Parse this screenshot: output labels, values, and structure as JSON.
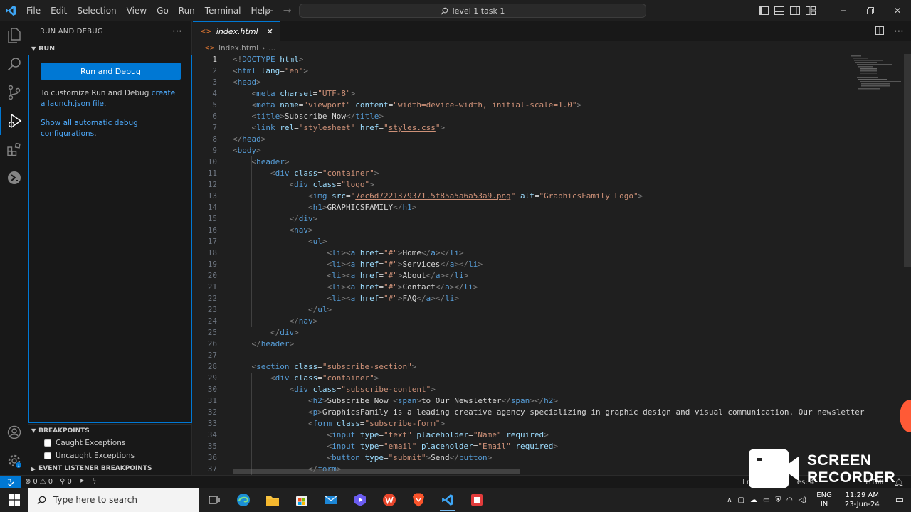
{
  "menu": [
    "File",
    "Edit",
    "Selection",
    "View",
    "Go",
    "Run",
    "Terminal",
    "Help"
  ],
  "command_center": {
    "text": "level 1 task 1"
  },
  "sidebar": {
    "header": "RUN AND DEBUG",
    "section": "RUN",
    "run_button": "Run and Debug",
    "customize_prefix": "To customize Run and Debug ",
    "customize_link": "create a launch.json file",
    "customize_suffix": ".",
    "show_all_link": "Show all automatic debug configurations",
    "show_all_suffix": ".",
    "breakpoints_title": "BREAKPOINTS",
    "caught": "Caught Exceptions",
    "uncaught": "Uncaught Exceptions",
    "event_listener": "EVENT LISTENER BREAKPOINTS"
  },
  "editor": {
    "tab": "index.html",
    "breadcrumb_file": "index.html",
    "breadcrumb_more": "..."
  },
  "code_lines": [
    [
      [
        "br",
        "<!"
      ],
      [
        "tag",
        "DOCTYPE"
      ],
      [
        "txt",
        " "
      ],
      [
        "attr",
        "html"
      ],
      [
        "br",
        ">"
      ]
    ],
    [
      [
        "br",
        "<"
      ],
      [
        "tag",
        "html"
      ],
      [
        "txt",
        " "
      ],
      [
        "attr",
        "lang"
      ],
      [
        "txt",
        "="
      ],
      [
        "str",
        "\"en\""
      ],
      [
        "br",
        ">"
      ]
    ],
    [
      [
        "br",
        "<"
      ],
      [
        "tag",
        "head"
      ],
      [
        "br",
        ">"
      ]
    ],
    [
      [
        "txt",
        "    "
      ],
      [
        "br",
        "<"
      ],
      [
        "tag",
        "meta"
      ],
      [
        "txt",
        " "
      ],
      [
        "attr",
        "charset"
      ],
      [
        "txt",
        "="
      ],
      [
        "str",
        "\"UTF-8\""
      ],
      [
        "br",
        ">"
      ]
    ],
    [
      [
        "txt",
        "    "
      ],
      [
        "br",
        "<"
      ],
      [
        "tag",
        "meta"
      ],
      [
        "txt",
        " "
      ],
      [
        "attr",
        "name"
      ],
      [
        "txt",
        "="
      ],
      [
        "str",
        "\"viewport\""
      ],
      [
        "txt",
        " "
      ],
      [
        "attr",
        "content"
      ],
      [
        "txt",
        "="
      ],
      [
        "str",
        "\"width=device-width, initial-scale=1.0\""
      ],
      [
        "br",
        ">"
      ]
    ],
    [
      [
        "txt",
        "    "
      ],
      [
        "br",
        "<"
      ],
      [
        "tag",
        "title"
      ],
      [
        "br",
        ">"
      ],
      [
        "txt",
        "Subscribe Now"
      ],
      [
        "br",
        "</"
      ],
      [
        "tag",
        "title"
      ],
      [
        "br",
        ">"
      ]
    ],
    [
      [
        "txt",
        "    "
      ],
      [
        "br",
        "<"
      ],
      [
        "tag",
        "link"
      ],
      [
        "txt",
        " "
      ],
      [
        "attr",
        "rel"
      ],
      [
        "txt",
        "="
      ],
      [
        "str",
        "\"stylesheet\""
      ],
      [
        "txt",
        " "
      ],
      [
        "attr",
        "href"
      ],
      [
        "txt",
        "="
      ],
      [
        "str",
        "\""
      ],
      [
        "stru",
        "styles.css"
      ],
      [
        "str",
        "\""
      ],
      [
        "br",
        ">"
      ]
    ],
    [
      [
        "br",
        "</"
      ],
      [
        "tag",
        "head"
      ],
      [
        "br",
        ">"
      ]
    ],
    [
      [
        "br",
        "<"
      ],
      [
        "tag",
        "body"
      ],
      [
        "br",
        ">"
      ]
    ],
    [
      [
        "txt",
        "    "
      ],
      [
        "br",
        "<"
      ],
      [
        "tag",
        "header"
      ],
      [
        "br",
        ">"
      ]
    ],
    [
      [
        "txt",
        "        "
      ],
      [
        "br",
        "<"
      ],
      [
        "tag",
        "div"
      ],
      [
        "txt",
        " "
      ],
      [
        "attr",
        "class"
      ],
      [
        "txt",
        "="
      ],
      [
        "str",
        "\"container\""
      ],
      [
        "br",
        ">"
      ]
    ],
    [
      [
        "txt",
        "            "
      ],
      [
        "br",
        "<"
      ],
      [
        "tag",
        "div"
      ],
      [
        "txt",
        " "
      ],
      [
        "attr",
        "class"
      ],
      [
        "txt",
        "="
      ],
      [
        "str",
        "\"logo\""
      ],
      [
        "br",
        ">"
      ]
    ],
    [
      [
        "txt",
        "                "
      ],
      [
        "br",
        "<"
      ],
      [
        "tag",
        "img"
      ],
      [
        "txt",
        " "
      ],
      [
        "attr",
        "src"
      ],
      [
        "txt",
        "="
      ],
      [
        "str",
        "\""
      ],
      [
        "stru",
        "7ec6d7221379371.5f85a5a6a53a9.png"
      ],
      [
        "str",
        "\""
      ],
      [
        "txt",
        " "
      ],
      [
        "attr",
        "alt"
      ],
      [
        "txt",
        "="
      ],
      [
        "str",
        "\"GraphicsFamily Logo\""
      ],
      [
        "br",
        ">"
      ]
    ],
    [
      [
        "txt",
        "                "
      ],
      [
        "br",
        "<"
      ],
      [
        "tag",
        "h1"
      ],
      [
        "br",
        ">"
      ],
      [
        "txt",
        "GRAPHICSFAMILY"
      ],
      [
        "br",
        "</"
      ],
      [
        "tag",
        "h1"
      ],
      [
        "br",
        ">"
      ]
    ],
    [
      [
        "txt",
        "            "
      ],
      [
        "br",
        "</"
      ],
      [
        "tag",
        "div"
      ],
      [
        "br",
        ">"
      ]
    ],
    [
      [
        "txt",
        "            "
      ],
      [
        "br",
        "<"
      ],
      [
        "tag",
        "nav"
      ],
      [
        "br",
        ">"
      ]
    ],
    [
      [
        "txt",
        "                "
      ],
      [
        "br",
        "<"
      ],
      [
        "tag",
        "ul"
      ],
      [
        "br",
        ">"
      ]
    ],
    [
      [
        "txt",
        "                    "
      ],
      [
        "br",
        "<"
      ],
      [
        "tag",
        "li"
      ],
      [
        "br",
        "><"
      ],
      [
        "tag",
        "a"
      ],
      [
        "txt",
        " "
      ],
      [
        "attr",
        "href"
      ],
      [
        "txt",
        "="
      ],
      [
        "str",
        "\"#\""
      ],
      [
        "br",
        ">"
      ],
      [
        "txt",
        "Home"
      ],
      [
        "br",
        "</"
      ],
      [
        "tag",
        "a"
      ],
      [
        "br",
        "></"
      ],
      [
        "tag",
        "li"
      ],
      [
        "br",
        ">"
      ]
    ],
    [
      [
        "txt",
        "                    "
      ],
      [
        "br",
        "<"
      ],
      [
        "tag",
        "li"
      ],
      [
        "br",
        "><"
      ],
      [
        "tag",
        "a"
      ],
      [
        "txt",
        " "
      ],
      [
        "attr",
        "href"
      ],
      [
        "txt",
        "="
      ],
      [
        "str",
        "\"#\""
      ],
      [
        "br",
        ">"
      ],
      [
        "txt",
        "Services"
      ],
      [
        "br",
        "</"
      ],
      [
        "tag",
        "a"
      ],
      [
        "br",
        "></"
      ],
      [
        "tag",
        "li"
      ],
      [
        "br",
        ">"
      ]
    ],
    [
      [
        "txt",
        "                    "
      ],
      [
        "br",
        "<"
      ],
      [
        "tag",
        "li"
      ],
      [
        "br",
        "><"
      ],
      [
        "tag",
        "a"
      ],
      [
        "txt",
        " "
      ],
      [
        "attr",
        "href"
      ],
      [
        "txt",
        "="
      ],
      [
        "str",
        "\"#\""
      ],
      [
        "br",
        ">"
      ],
      [
        "txt",
        "About"
      ],
      [
        "br",
        "</"
      ],
      [
        "tag",
        "a"
      ],
      [
        "br",
        "></"
      ],
      [
        "tag",
        "li"
      ],
      [
        "br",
        ">"
      ]
    ],
    [
      [
        "txt",
        "                    "
      ],
      [
        "br",
        "<"
      ],
      [
        "tag",
        "li"
      ],
      [
        "br",
        "><"
      ],
      [
        "tag",
        "a"
      ],
      [
        "txt",
        " "
      ],
      [
        "attr",
        "href"
      ],
      [
        "txt",
        "="
      ],
      [
        "str",
        "\"#\""
      ],
      [
        "br",
        ">"
      ],
      [
        "txt",
        "Contact"
      ],
      [
        "br",
        "</"
      ],
      [
        "tag",
        "a"
      ],
      [
        "br",
        "></"
      ],
      [
        "tag",
        "li"
      ],
      [
        "br",
        ">"
      ]
    ],
    [
      [
        "txt",
        "                    "
      ],
      [
        "br",
        "<"
      ],
      [
        "tag",
        "li"
      ],
      [
        "br",
        "><"
      ],
      [
        "tag",
        "a"
      ],
      [
        "txt",
        " "
      ],
      [
        "attr",
        "href"
      ],
      [
        "txt",
        "="
      ],
      [
        "str",
        "\"#\""
      ],
      [
        "br",
        ">"
      ],
      [
        "txt",
        "FAQ"
      ],
      [
        "br",
        "</"
      ],
      [
        "tag",
        "a"
      ],
      [
        "br",
        "></"
      ],
      [
        "tag",
        "li"
      ],
      [
        "br",
        ">"
      ]
    ],
    [
      [
        "txt",
        "                "
      ],
      [
        "br",
        "</"
      ],
      [
        "tag",
        "ul"
      ],
      [
        "br",
        ">"
      ]
    ],
    [
      [
        "txt",
        "            "
      ],
      [
        "br",
        "</"
      ],
      [
        "tag",
        "nav"
      ],
      [
        "br",
        ">"
      ]
    ],
    [
      [
        "txt",
        "        "
      ],
      [
        "br",
        "</"
      ],
      [
        "tag",
        "div"
      ],
      [
        "br",
        ">"
      ]
    ],
    [
      [
        "txt",
        "    "
      ],
      [
        "br",
        "</"
      ],
      [
        "tag",
        "header"
      ],
      [
        "br",
        ">"
      ]
    ],
    [],
    [
      [
        "txt",
        "    "
      ],
      [
        "br",
        "<"
      ],
      [
        "tag",
        "section"
      ],
      [
        "txt",
        " "
      ],
      [
        "attr",
        "class"
      ],
      [
        "txt",
        "="
      ],
      [
        "str",
        "\"subscribe-section\""
      ],
      [
        "br",
        ">"
      ]
    ],
    [
      [
        "txt",
        "        "
      ],
      [
        "br",
        "<"
      ],
      [
        "tag",
        "div"
      ],
      [
        "txt",
        " "
      ],
      [
        "attr",
        "class"
      ],
      [
        "txt",
        "="
      ],
      [
        "str",
        "\"container\""
      ],
      [
        "br",
        ">"
      ]
    ],
    [
      [
        "txt",
        "            "
      ],
      [
        "br",
        "<"
      ],
      [
        "tag",
        "div"
      ],
      [
        "txt",
        " "
      ],
      [
        "attr",
        "class"
      ],
      [
        "txt",
        "="
      ],
      [
        "str",
        "\"subscribe-content\""
      ],
      [
        "br",
        ">"
      ]
    ],
    [
      [
        "txt",
        "                "
      ],
      [
        "br",
        "<"
      ],
      [
        "tag",
        "h2"
      ],
      [
        "br",
        ">"
      ],
      [
        "txt",
        "Subscribe Now "
      ],
      [
        "br",
        "<"
      ],
      [
        "tag",
        "span"
      ],
      [
        "br",
        ">"
      ],
      [
        "txt",
        "to Our Newsletter"
      ],
      [
        "br",
        "</"
      ],
      [
        "tag",
        "span"
      ],
      [
        "br",
        "></"
      ],
      [
        "tag",
        "h2"
      ],
      [
        "br",
        ">"
      ]
    ],
    [
      [
        "txt",
        "                "
      ],
      [
        "br",
        "<"
      ],
      [
        "tag",
        "p"
      ],
      [
        "br",
        ">"
      ],
      [
        "txt",
        "GraphicsFamily is a leading creative agency specializing in graphic design and visual communication. Our newsletter"
      ]
    ],
    [
      [
        "txt",
        "                "
      ],
      [
        "br",
        "<"
      ],
      [
        "tag",
        "form"
      ],
      [
        "txt",
        " "
      ],
      [
        "attr",
        "class"
      ],
      [
        "txt",
        "="
      ],
      [
        "str",
        "\"subscribe-form\""
      ],
      [
        "br",
        ">"
      ]
    ],
    [
      [
        "txt",
        "                    "
      ],
      [
        "br",
        "<"
      ],
      [
        "tag",
        "input"
      ],
      [
        "txt",
        " "
      ],
      [
        "attr",
        "type"
      ],
      [
        "txt",
        "="
      ],
      [
        "str",
        "\"text\""
      ],
      [
        "txt",
        " "
      ],
      [
        "attr",
        "placeholder"
      ],
      [
        "txt",
        "="
      ],
      [
        "str",
        "\"Name\""
      ],
      [
        "txt",
        " "
      ],
      [
        "attr",
        "required"
      ],
      [
        "br",
        ">"
      ]
    ],
    [
      [
        "txt",
        "                    "
      ],
      [
        "br",
        "<"
      ],
      [
        "tag",
        "input"
      ],
      [
        "txt",
        " "
      ],
      [
        "attr",
        "type"
      ],
      [
        "txt",
        "="
      ],
      [
        "str",
        "\"email\""
      ],
      [
        "txt",
        " "
      ],
      [
        "attr",
        "placeholder"
      ],
      [
        "txt",
        "="
      ],
      [
        "str",
        "\"Email\""
      ],
      [
        "txt",
        " "
      ],
      [
        "attr",
        "required"
      ],
      [
        "br",
        ">"
      ]
    ],
    [
      [
        "txt",
        "                    "
      ],
      [
        "br",
        "<"
      ],
      [
        "tag",
        "button"
      ],
      [
        "txt",
        " "
      ],
      [
        "attr",
        "type"
      ],
      [
        "txt",
        "="
      ],
      [
        "str",
        "\"submit\""
      ],
      [
        "br",
        ">"
      ],
      [
        "txt",
        "Send"
      ],
      [
        "br",
        "</"
      ],
      [
        "tag",
        "button"
      ],
      [
        "br",
        ">"
      ]
    ],
    [
      [
        "txt",
        "                "
      ],
      [
        "br",
        "</"
      ],
      [
        "tag",
        "form"
      ],
      [
        "br",
        ">"
      ]
    ]
  ],
  "status": {
    "errors": "0",
    "warnings": "0",
    "ports": "0",
    "position": "Ln 1,",
    "spaces": "es: 4",
    "language": "HTML"
  },
  "taskbar": {
    "search_placeholder": "Type here to search",
    "lang_top": "ENG",
    "lang_bottom": "IN",
    "time": "11:29 AM",
    "date": "23-Jun-24"
  },
  "watermark": {
    "line1": "SCREEN",
    "line2": "RECORDER"
  },
  "colors": {
    "accent": "#0078d4",
    "background": "#1e1e1e",
    "sidebar": "#181818"
  }
}
